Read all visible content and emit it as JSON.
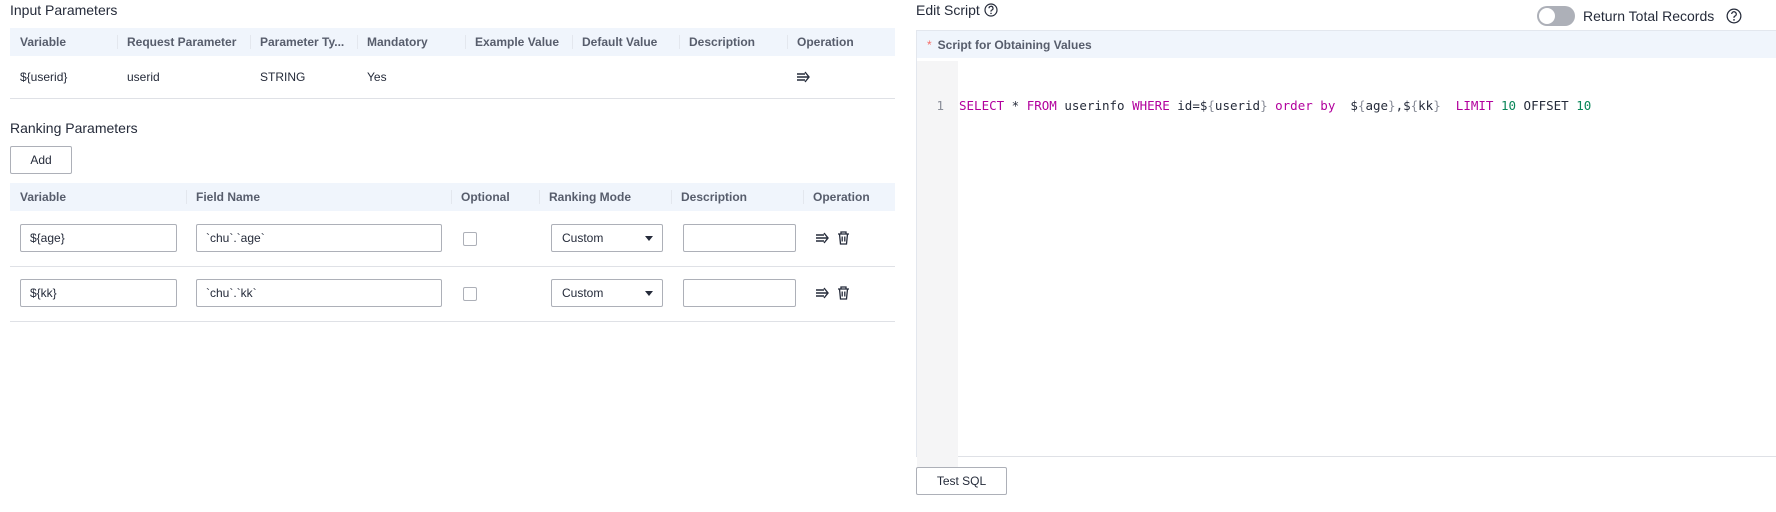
{
  "input_params": {
    "title": "Input Parameters",
    "columns": [
      "Variable",
      "Request Parameter",
      "Parameter Ty...",
      "Mandatory",
      "Example Value",
      "Default Value",
      "Description",
      "Operation"
    ],
    "rows": [
      {
        "variable": "${userid}",
        "request_parameter": "userid",
        "parameter_type": "STRING",
        "mandatory": "Yes",
        "example_value": "",
        "default_value": "",
        "description": ""
      }
    ]
  },
  "ranking_params": {
    "title": "Ranking Parameters",
    "add_label": "Add",
    "columns": [
      "Variable",
      "Field Name",
      "Optional",
      "Ranking Mode",
      "Description",
      "Operation"
    ],
    "rows": [
      {
        "variable": "${age}",
        "field_name": "`chu`.`age`",
        "optional": false,
        "ranking_mode": "Custom",
        "description": ""
      },
      {
        "variable": "${kk}",
        "field_name": "`chu`.`kk`",
        "optional": false,
        "ranking_mode": "Custom",
        "description": ""
      }
    ]
  },
  "edit_script": {
    "title": "Edit Script",
    "return_total_label": "Return Total Records",
    "return_total_enabled": false,
    "required_mark": "*",
    "script_label": "Script for Obtaining Values",
    "line_number": "1",
    "code_tokens": {
      "t1": "SELECT",
      "t2": " * ",
      "t3": "FROM",
      "t4": " userinfo ",
      "t5": "WHERE",
      "t6": " id=$",
      "t7": "{",
      "t8": "userid",
      "t9": "}",
      "t10": " order by",
      "t11": "  $",
      "t12": "{",
      "t13": "age",
      "t14": "}",
      "t15": ",$",
      "t16": "{",
      "t17": "kk",
      "t18": "}",
      "t19": "  LIMIT",
      "t20": " 10",
      "t21": " OFFSET",
      "t22": " 10"
    },
    "test_label": "Test SQL"
  },
  "colors": {
    "header_bg": "#f0f5fc",
    "keyword": "#b2009d",
    "number": "#098658",
    "required": "#f66f6a"
  }
}
